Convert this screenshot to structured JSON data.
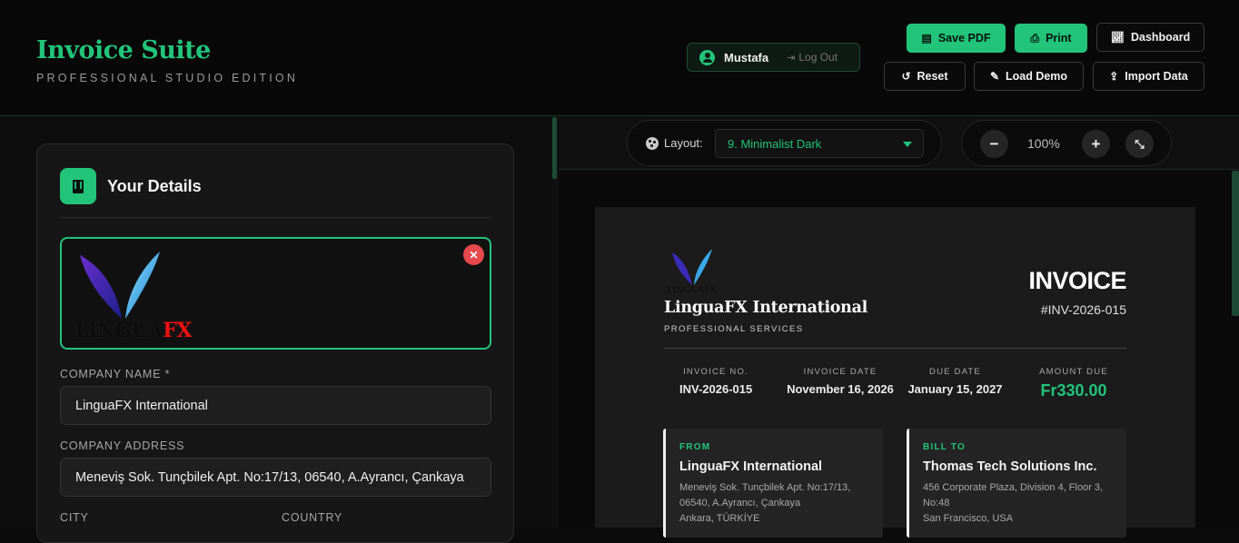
{
  "app": {
    "title": "Invoice Suite",
    "subtitle": "PROFESSIONAL STUDIO EDITION"
  },
  "user": {
    "name": "Mustafa",
    "logout_label": "Log Out"
  },
  "toolbar": {
    "save_pdf": "Save PDF",
    "print": "Print",
    "dashboard": "Dashboard",
    "reset": "Reset",
    "load_demo": "Load Demo",
    "import_data": "Import Data"
  },
  "details": {
    "title": "Your Details",
    "logo_text_dark": "LINGUA",
    "logo_text_red": "FX",
    "company_name_label": "COMPANY NAME *",
    "company_name_value": "LinguaFX International",
    "company_address_label": "COMPANY ADDRESS",
    "company_address_value": "Meneviş Sok. Tunçbilek Apt. No:17/13, 06540, A.Ayrancı, Çankaya",
    "city_label": "CITY",
    "country_label": "COUNTRY"
  },
  "preview": {
    "layout_label": "Layout:",
    "layout_value": "9. Minimalist Dark",
    "zoom": "100%",
    "zoom_out": "−",
    "zoom_in": "+"
  },
  "invoice": {
    "logo_text": "LINGUAFX",
    "company": "LinguaFX International",
    "tagline": "PROFESSIONAL SERVICES",
    "title": "INVOICE",
    "number": "#INV-2026-015",
    "meta": [
      {
        "label": "INVOICE NO.",
        "value": "INV-2026-015"
      },
      {
        "label": "INVOICE DATE",
        "value": "November 16, 2026"
      },
      {
        "label": "DUE DATE",
        "value": "January 15, 2027"
      },
      {
        "label": "AMOUNT DUE",
        "value": "Fr330.00"
      }
    ],
    "from": {
      "label": "FROM",
      "name": "LinguaFX International",
      "address": "Meneviş Sok. Tunçbilek Apt. No:17/13, 06540, A.Ayrancı, Çankaya",
      "city_country": "Ankara, TÜRKİYE"
    },
    "bill_to": {
      "label": "BILL TO",
      "name": "Thomas Tech Solutions Inc.",
      "address": "456 Corporate Plaza, Division 4, Floor 3, No:48",
      "city_country": "San Francisco, USA"
    }
  },
  "colors": {
    "accent": "#22c47a",
    "danger": "#e5484d",
    "background": "#0b0b0b"
  }
}
